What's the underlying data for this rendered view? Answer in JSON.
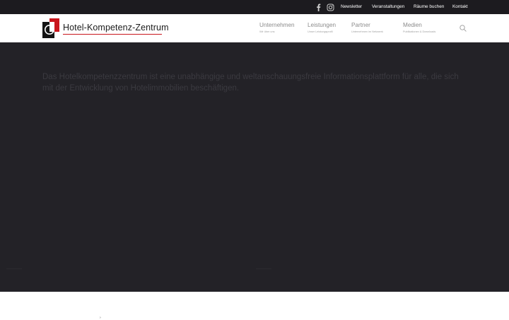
{
  "topbar": {
    "social": [
      {
        "icon": "facebook-icon"
      },
      {
        "icon": "instagram-icon"
      }
    ],
    "links": [
      "Newsletter",
      "Veranstaltungen",
      "Räume buchen",
      "Kontakt"
    ]
  },
  "header": {
    "logo_text": "Hotel-Kompetenz-Zentrum",
    "nav": [
      {
        "title": "Unternehmen",
        "subtitle": "Wir über uns"
      },
      {
        "title": "Leistungen",
        "subtitle": "Unser Leistungsprofil"
      },
      {
        "title": "Partner",
        "subtitle": "Unternehmen im Netzwerk"
      },
      {
        "title": "Medien",
        "subtitle": "Publikationen & Downloads"
      }
    ],
    "search_icon": "search-icon"
  },
  "hero": {
    "kicker": "",
    "text": "Das Hotelkompetenzzentrum ist eine unabhängige und weltanschauungsfreie Informationsplattform für alle, die sich mit der Entwicklung von Hotelimmobilien beschäftigen."
  },
  "colors": {
    "topbar": "#1c1b1f",
    "hero": "#232227",
    "accent": "#c9151c"
  }
}
